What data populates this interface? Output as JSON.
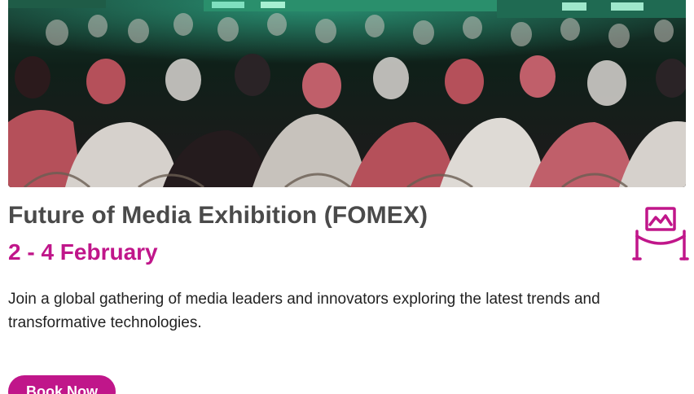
{
  "event": {
    "image": {
      "subject": "audience seated at an exhibition stage",
      "colors": {
        "stage_glow": "#2fae8a",
        "thobe_white": "#d9d6d2",
        "shemagh_red": "#b5505a",
        "dark": "#0b1412"
      }
    },
    "title": "Future of Media Exhibition (FOMEX)",
    "date": "2 - 4 February",
    "description": "Join a global gathering of media leaders and innovators exploring the latest trends and transformative technologies.",
    "icon": "exhibition-icon",
    "cta_label": "Book Now"
  },
  "colors": {
    "accent": "#c0168a",
    "title": "#4a4a4a",
    "body": "#222222"
  }
}
